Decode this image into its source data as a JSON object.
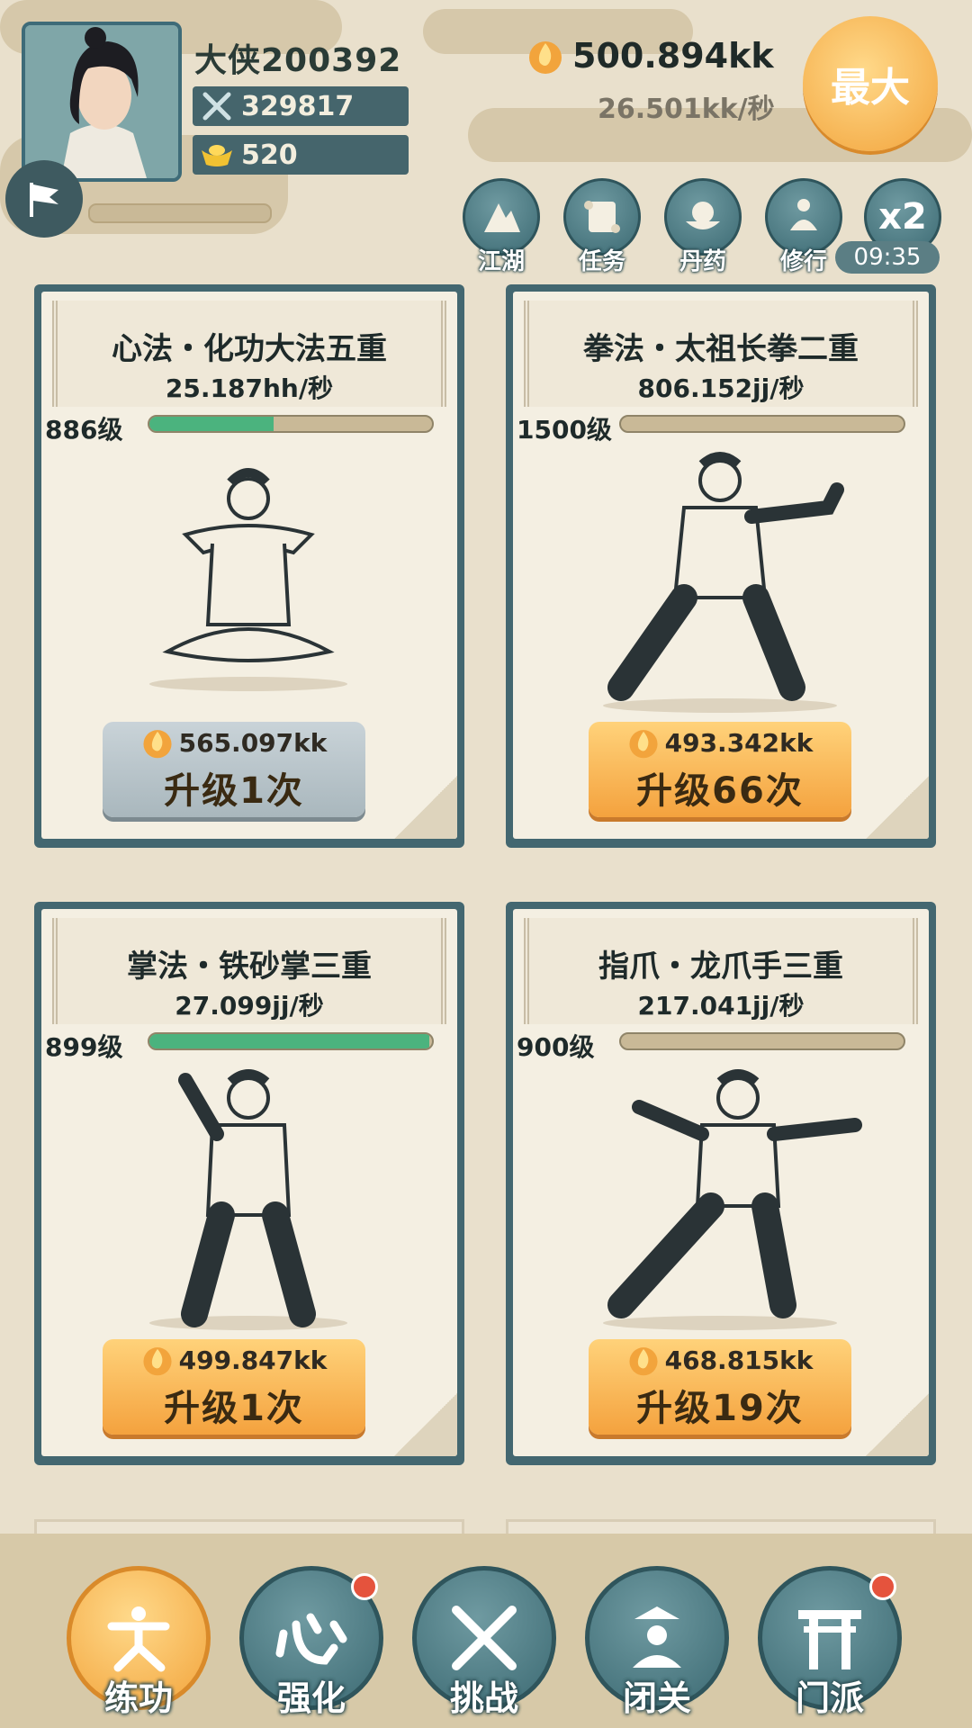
{
  "player": {
    "name": "大侠200392",
    "power": "329817",
    "ingots": "520"
  },
  "currency": {
    "gold": "500.894kk",
    "rate": "26.501kk/秒"
  },
  "max_button": "最大",
  "quick_menu": [
    {
      "label": "江湖",
      "icon": "mountain-icon"
    },
    {
      "label": "任务",
      "icon": "scroll-icon"
    },
    {
      "label": "丹药",
      "icon": "pill-bowl-icon"
    },
    {
      "label": "修行",
      "icon": "meditate-icon"
    },
    {
      "label": "x2",
      "icon": "double-icon"
    }
  ],
  "boost_timer": "09:35",
  "skills": [
    {
      "name": "心法・化功大法五重",
      "rate": "25.187hh/秒",
      "level": "886级",
      "progress": 0.44,
      "cost": "565.097kk",
      "upgrade": "升级1次",
      "affordable": false
    },
    {
      "name": "拳法・太祖长拳二重",
      "rate": "806.152jj/秒",
      "level": "1500级",
      "progress": 0.0,
      "cost": "493.342kk",
      "upgrade": "升级66次",
      "affordable": true
    },
    {
      "name": "掌法・铁砂掌三重",
      "rate": "27.099jj/秒",
      "level": "899级",
      "progress": 0.99,
      "cost": "499.847kk",
      "upgrade": "升级1次",
      "affordable": true
    },
    {
      "name": "指爪・龙爪手三重",
      "rate": "217.041jj/秒",
      "level": "900级",
      "progress": 0.0,
      "cost": "468.815kk",
      "upgrade": "升级19次",
      "affordable": true
    }
  ],
  "bottom_nav": [
    {
      "label": "练功",
      "icon": "martial-stance-icon",
      "active": true,
      "badge": false
    },
    {
      "label": "强化",
      "icon": "heart-char-icon",
      "active": false,
      "badge": true
    },
    {
      "label": "挑战",
      "icon": "crossed-swords-icon",
      "active": false,
      "badge": false
    },
    {
      "label": "闭关",
      "icon": "seclusion-icon",
      "active": false,
      "badge": false
    },
    {
      "label": "门派",
      "icon": "gate-icon",
      "active": false,
      "badge": true
    }
  ],
  "colors": {
    "accent_orange": "#f4a23e",
    "teal": "#436770",
    "progress_green": "#4bb37e",
    "badge_red": "#e5533d"
  }
}
